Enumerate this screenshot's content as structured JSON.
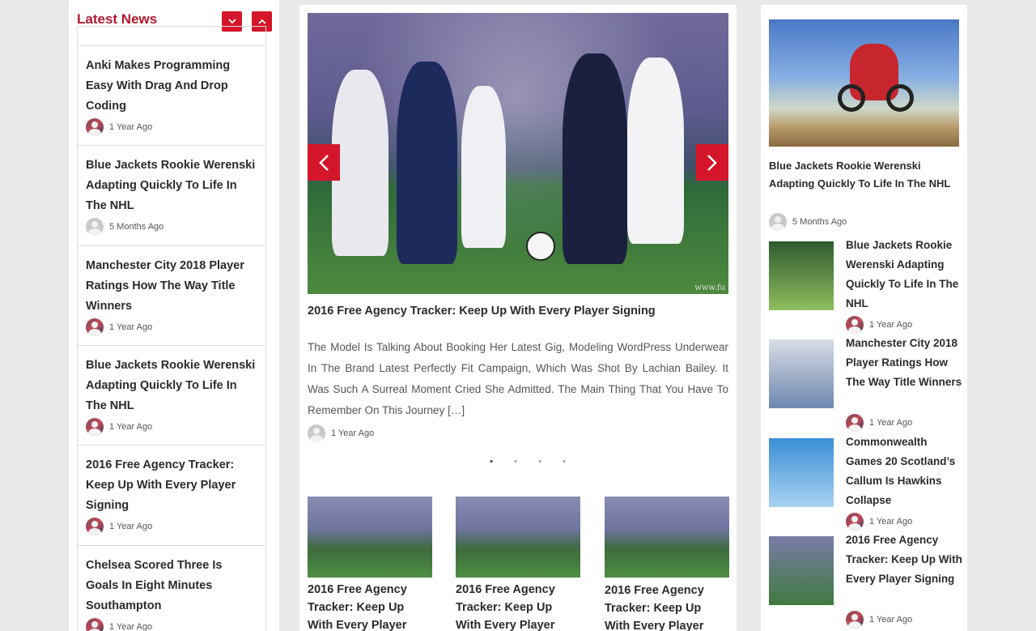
{
  "left_panel": {
    "heading": "Latest News",
    "items": [
      {
        "title": "Anki Makes Programming Easy With Drag And Drop Coding",
        "time": "1 Year Ago"
      },
      {
        "title": "Blue Jackets Rookie Werenski Adapting Quickly To Life In The NHL",
        "time": "5 Months Ago"
      },
      {
        "title": "Manchester City 2018 Player Ratings How The Way Title Winners",
        "time": "1 Year Ago"
      },
      {
        "title": "Blue Jackets Rookie Werenski Adapting Quickly To Life In The NHL",
        "time": "1 Year Ago"
      },
      {
        "title": "2016 Free Agency Tracker: Keep Up With Every Player Signing",
        "time": "1 Year Ago"
      },
      {
        "title": "Chelsea Scored Three Is Goals In Eight Minutes Southampton",
        "time": "1 Year Ago"
      }
    ]
  },
  "slider": {
    "title": "2016 Free Agency Tracker: Keep Up With Every Player Signing",
    "body": "The Model Is Talking About Booking Her Latest Gig, Modeling WordPress Underwear In The Brand Latest Perfectly Fit Campaign, Which Was Shot By Lachian Bailey. It Was Such A Surreal Moment Cried She Admitted. The Main Thing That You Have To Remember On This Journey […]",
    "time": "1 Year Ago",
    "image_caption": "www.fu",
    "dots": [
      "•",
      "•",
      "•",
      "•"
    ]
  },
  "thumbs": [
    {
      "title": "2016 Free Agency Tracker: Keep Up With Every Player"
    },
    {
      "title": "2016 Free Agency Tracker: Keep Up With Every Player"
    },
    {
      "title": "2016 Free Agency Tracker: Keep Up With Every Player"
    }
  ],
  "right_panel": {
    "hero": {
      "title": "Blue Jackets Rookie Werenski Adapting Quickly To Life In The NHL",
      "time": "5 Months Ago"
    },
    "items": [
      {
        "title": "Blue Jackets Rookie Werenski Adapting Quickly To Life In The NHL",
        "time": "1 Year Ago"
      },
      {
        "title": "Manchester City 2018 Player Ratings How The Way Title Winners",
        "time": "1 Year Ago"
      },
      {
        "title": "Commonwealth Games 20 Scotland’s Callum Is Hawkins Collapse",
        "time": "1 Year Ago"
      },
      {
        "title": "2016 Free Agency Tracker: Keep Up With Every Player Signing",
        "time": "1 Year Ago"
      }
    ]
  },
  "icons": {
    "prev": "chevron-left-icon",
    "next": "chevron-right-icon",
    "scroll_down": "chevron-down-icon",
    "scroll_up": "chevron-up-icon",
    "avatar": "user-avatar-icon"
  },
  "colors": {
    "accent": "#d5152a",
    "heading": "#b5172e",
    "background": "#e9e9e9"
  }
}
